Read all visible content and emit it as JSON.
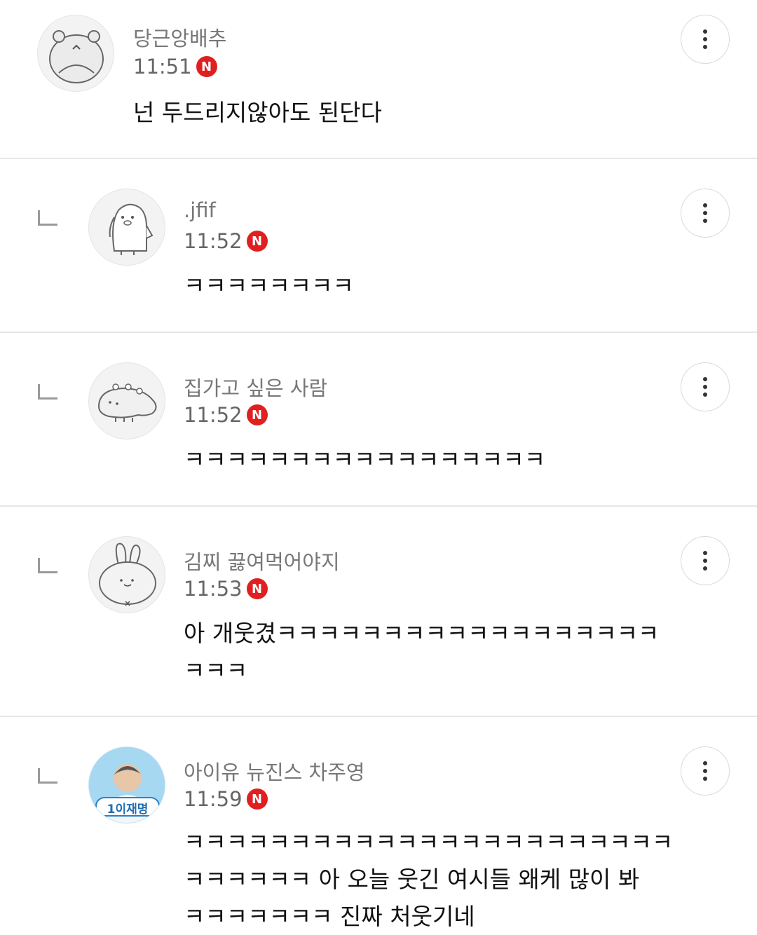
{
  "comments": [
    {
      "author": "당근앙배추",
      "time": "11:51",
      "badge": "N",
      "text": "넌 두드리지않아도 된단다",
      "avatar_icon": "hamster-avatar-icon",
      "reply": false
    },
    {
      "author": ".jfif",
      "time": "11:52",
      "badge": "N",
      "text": "ㅋㅋㅋㅋㅋㅋㅋㅋ",
      "avatar_icon": "penguin-avatar-icon",
      "reply": true
    },
    {
      "author": "집가고 싶은 사람",
      "time": "11:52",
      "badge": "N",
      "text": "ㅋㅋㅋㅋㅋㅋㅋㅋㅋㅋㅋㅋㅋㅋㅋㅋㅋ",
      "avatar_icon": "dinosaur-avatar-icon",
      "reply": true
    },
    {
      "author": "김찌 끓여먹어야지",
      "time": "11:53",
      "badge": "N",
      "text": "아 개웃겼ㅋㅋㅋㅋㅋㅋㅋㅋㅋㅋㅋㅋㅋㅋㅋㅋㅋㅋ\nㅋㅋㅋ",
      "avatar_icon": "rabbit-avatar-icon",
      "reply": true
    },
    {
      "author": "아이유 뉴진스 차주영",
      "time": "11:59",
      "badge": "N",
      "text": "ㅋㅋㅋㅋㅋㅋㅋㅋㅋㅋㅋㅋㅋㅋㅋㅋㅋㅋㅋㅋㅋㅋㅋ\nㅋㅋㅋㅋㅋㅋ 아 오늘 웃긴 여시들 왜케 많이 봐\nㅋㅋㅋㅋㅋㅋㅋ 진짜 처웃기네",
      "avatar_icon": "photo-avatar-icon",
      "avatar_caption": "1이재명",
      "reply": true
    }
  ],
  "colors": {
    "badge": "#e02020",
    "author": "#777777",
    "divider": "#e6e6e6"
  }
}
